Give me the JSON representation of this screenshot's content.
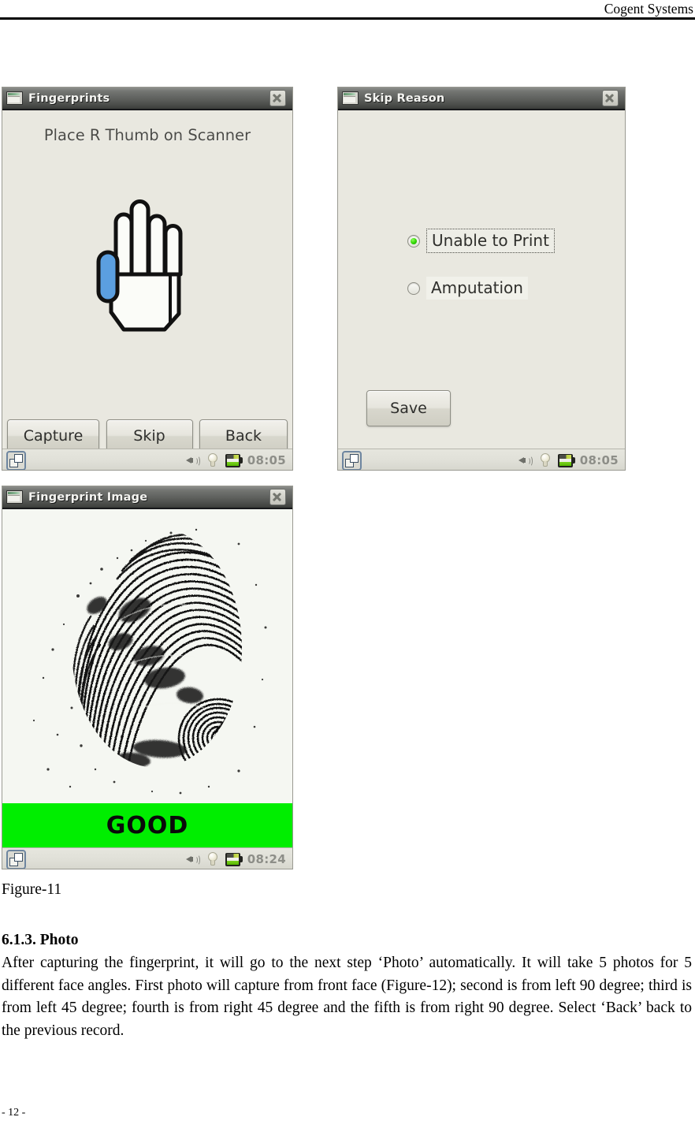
{
  "header": {
    "company": "Cogent Systems"
  },
  "windows": {
    "fingerprints": {
      "title": "Fingerprints",
      "prompt": "Place R Thumb on Scanner",
      "hand_icon": "right-hand-thumb-highlight",
      "buttons": {
        "capture": "Capture",
        "skip": "Skip",
        "back": "Back"
      },
      "taskbar": {
        "time": "08:05",
        "icons": [
          "task-switcher-icon",
          "speaker-icon",
          "lightbulb-icon",
          "battery-icon"
        ]
      }
    },
    "skip_reason": {
      "title": "Skip Reason",
      "options": [
        {
          "label": "Unable to Print",
          "selected": true
        },
        {
          "label": "Amputation",
          "selected": false
        }
      ],
      "buttons": {
        "save": "Save"
      },
      "taskbar": {
        "time": "08:05",
        "icons": [
          "task-switcher-icon",
          "speaker-icon",
          "lightbulb-icon",
          "battery-icon"
        ]
      }
    },
    "fingerprint_image": {
      "title": "Fingerprint Image",
      "image_alt": "captured-thumb-fingerprint",
      "quality": {
        "text": "GOOD",
        "color": "#00EE00"
      },
      "taskbar": {
        "time": "08:24",
        "icons": [
          "task-switcher-icon",
          "speaker-icon",
          "lightbulb-icon",
          "battery-icon"
        ]
      }
    }
  },
  "document": {
    "figure_caption": "Figure-11",
    "section_heading": "6.1.3. Photo",
    "body_paragraph": "After capturing the fingerprint, it will go to the next step ‘Photo’ automatically. It will take 5 photos for 5 different face angles. First photo will capture from front face (Figure-12); second is from left 90 degree; third is from left 45 degree; fourth is from right 45 degree and the fifth is from right 90 degree. Select ‘Back’ back to the previous record.",
    "page_number": "- 12 -"
  }
}
